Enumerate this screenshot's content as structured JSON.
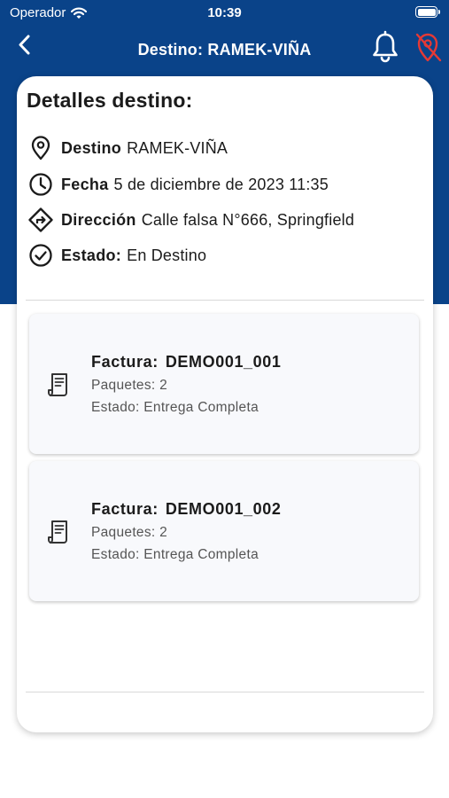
{
  "status_bar": {
    "carrier": "Operador",
    "time": "10:39"
  },
  "nav": {
    "title": "Destino: RAMEK-VIÑA"
  },
  "details": {
    "heading": "Detalles destino:",
    "rows": [
      {
        "icon": "map-pin-icon",
        "label": "Destino",
        "value": "RAMEK-VIÑA"
      },
      {
        "icon": "clock-icon",
        "label": "Fecha",
        "value": "5 de diciembre de 2023 11:35"
      },
      {
        "icon": "direction-sign-icon",
        "label": "Dirección",
        "value": "Calle falsa N°666, Springfield"
      },
      {
        "icon": "check-circle-icon",
        "label": "Estado:",
        "value": "En Destino"
      }
    ]
  },
  "invoices": [
    {
      "title_label": "Factura:",
      "number": "DEMO001_001",
      "packages": "Paquetes: 2",
      "status": "Estado: Entrega Completa"
    },
    {
      "title_label": "Factura:",
      "number": "DEMO001_002",
      "packages": "Paquetes: 2",
      "status": "Estado: Entrega Completa"
    }
  ],
  "colors": {
    "header_blue": "#0a4389",
    "gps_off_red": "#e53935",
    "card_bg": "#f8f9fc"
  }
}
